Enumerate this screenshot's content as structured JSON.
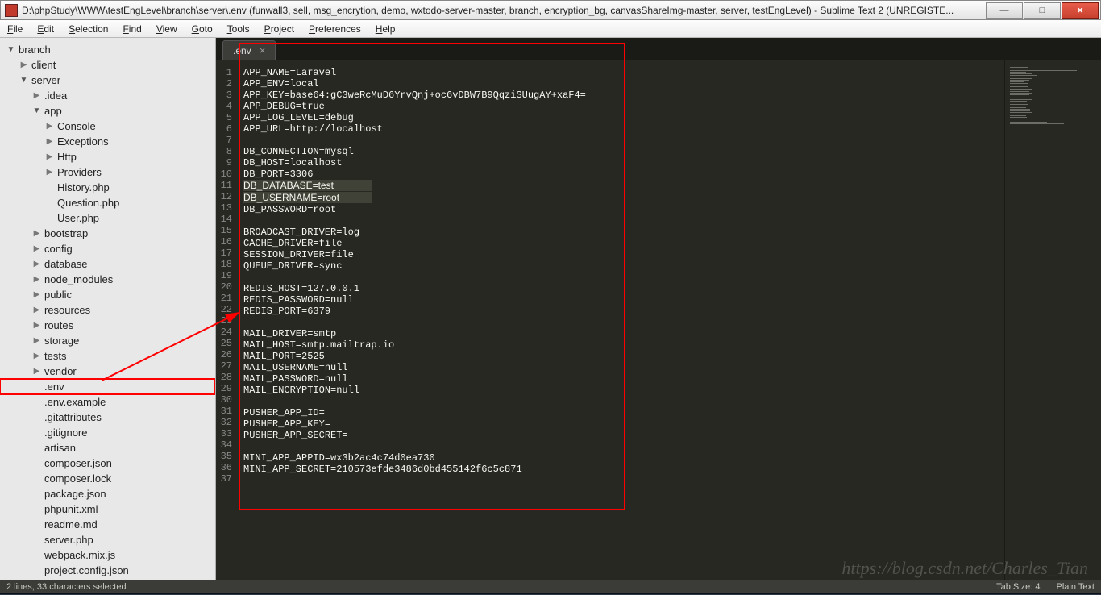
{
  "title": "D:\\phpStudy\\WWW\\testEngLevel\\branch\\server\\.env (funwall3, sell, msg_encrytion, demo, wxtodo-server-master, branch, encryption_bg, canvasShareImg-master, server, testEngLevel) - Sublime Text 2 (UNREGISTE...",
  "winbtns": {
    "min": "—",
    "max": "□",
    "close": "×"
  },
  "menu": [
    "File",
    "Edit",
    "Selection",
    "Find",
    "View",
    "Goto",
    "Tools",
    "Project",
    "Preferences",
    "Help"
  ],
  "tree": [
    {
      "d": 0,
      "t": "folder-open",
      "n": "branch"
    },
    {
      "d": 1,
      "t": "folder",
      "n": "client"
    },
    {
      "d": 1,
      "t": "folder-open",
      "n": "server"
    },
    {
      "d": 2,
      "t": "folder",
      "n": ".idea"
    },
    {
      "d": 2,
      "t": "folder-open",
      "n": "app"
    },
    {
      "d": 3,
      "t": "folder",
      "n": "Console"
    },
    {
      "d": 3,
      "t": "folder",
      "n": "Exceptions"
    },
    {
      "d": 3,
      "t": "folder",
      "n": "Http"
    },
    {
      "d": 3,
      "t": "folder",
      "n": "Providers"
    },
    {
      "d": 3,
      "t": "file",
      "n": "History.php"
    },
    {
      "d": 3,
      "t": "file",
      "n": "Question.php"
    },
    {
      "d": 3,
      "t": "file",
      "n": "User.php"
    },
    {
      "d": 2,
      "t": "folder",
      "n": "bootstrap"
    },
    {
      "d": 2,
      "t": "folder",
      "n": "config"
    },
    {
      "d": 2,
      "t": "folder",
      "n": "database"
    },
    {
      "d": 2,
      "t": "folder",
      "n": "node_modules"
    },
    {
      "d": 2,
      "t": "folder",
      "n": "public"
    },
    {
      "d": 2,
      "t": "folder",
      "n": "resources"
    },
    {
      "d": 2,
      "t": "folder",
      "n": "routes"
    },
    {
      "d": 2,
      "t": "folder",
      "n": "storage"
    },
    {
      "d": 2,
      "t": "folder",
      "n": "tests"
    },
    {
      "d": 2,
      "t": "folder",
      "n": "vendor"
    },
    {
      "d": 2,
      "t": "file",
      "n": ".env",
      "hl": true
    },
    {
      "d": 2,
      "t": "file",
      "n": ".env.example"
    },
    {
      "d": 2,
      "t": "file",
      "n": ".gitattributes"
    },
    {
      "d": 2,
      "t": "file",
      "n": ".gitignore"
    },
    {
      "d": 2,
      "t": "file",
      "n": "artisan"
    },
    {
      "d": 2,
      "t": "file",
      "n": "composer.json"
    },
    {
      "d": 2,
      "t": "file",
      "n": "composer.lock"
    },
    {
      "d": 2,
      "t": "file",
      "n": "package.json"
    },
    {
      "d": 2,
      "t": "file",
      "n": "phpunit.xml"
    },
    {
      "d": 2,
      "t": "file",
      "n": "readme.md"
    },
    {
      "d": 2,
      "t": "file",
      "n": "server.php"
    },
    {
      "d": 2,
      "t": "file",
      "n": "webpack.mix.js"
    },
    {
      "d": 2,
      "t": "file",
      "n": "project.config.json"
    }
  ],
  "tab": {
    "name": ".env",
    "close": "×"
  },
  "lines": [
    "APP_NAME=Laravel",
    "APP_ENV=local",
    "APP_KEY=base64:gC3weRcMuD6YrvQnj+oc6vDBW7B9QqziSUugAY+xaF4=",
    "APP_DEBUG=true",
    "APP_LOG_LEVEL=debug",
    "APP_URL=http://localhost",
    "",
    "DB_CONNECTION=mysql",
    "DB_HOST=localhost",
    "DB_PORT=3306",
    "DB_DATABASE=test",
    "DB_USERNAME=root",
    "DB_PASSWORD=root",
    "",
    "BROADCAST_DRIVER=log",
    "CACHE_DRIVER=file",
    "SESSION_DRIVER=file",
    "QUEUE_DRIVER=sync",
    "",
    "REDIS_HOST=127.0.0.1",
    "REDIS_PASSWORD=null",
    "REDIS_PORT=6379",
    "",
    "MAIL_DRIVER=smtp",
    "MAIL_HOST=smtp.mailtrap.io",
    "MAIL_PORT=2525",
    "MAIL_USERNAME=null",
    "MAIL_PASSWORD=null",
    "MAIL_ENCRYPTION=null",
    "",
    "PUSHER_APP_ID=",
    "PUSHER_APP_KEY=",
    "PUSHER_APP_SECRET=",
    "",
    "MINI_APP_APPID=wx3b2ac4c74d0ea730",
    "MINI_APP_SECRET=210573efde3486d0bd455142f6c5c871",
    ""
  ],
  "hl_lines": [
    11,
    12
  ],
  "status": {
    "left": "2 lines, 33 characters selected",
    "tabsize": "Tab Size: 4",
    "syntax": "Plain Text"
  },
  "watermark": "https://blog.csdn.net/Charles_Tian"
}
